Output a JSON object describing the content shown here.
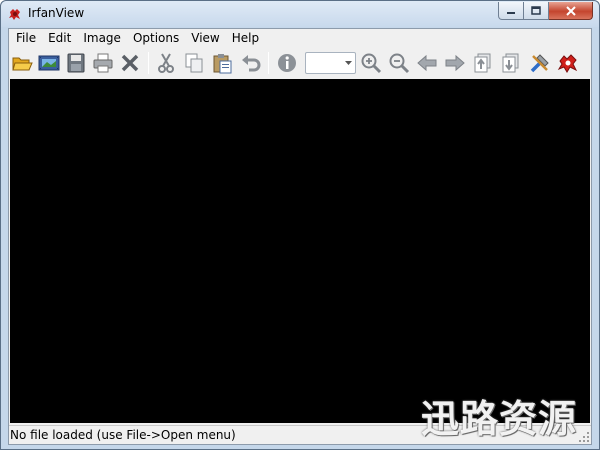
{
  "window": {
    "title": "IrfanView"
  },
  "menu": [
    "File",
    "Edit",
    "Image",
    "Options",
    "View",
    "Help"
  ],
  "toolbar": {
    "icons": [
      "open-folder-icon",
      "slideshow-icon",
      "save-icon",
      "print-icon",
      "delete-icon",
      "cut-icon",
      "copy-icon",
      "paste-icon",
      "undo-icon",
      "info-icon",
      "zoom-in-icon",
      "zoom-out-icon",
      "previous-icon",
      "next-icon",
      "first-page-icon",
      "last-page-icon",
      "settings-icon",
      "irfanview-icon"
    ],
    "zoom_value": ""
  },
  "status": {
    "text": "No file loaded (use File->Open menu)"
  },
  "watermark": "迅路资源",
  "colors": {
    "viewer_bg": "#000000",
    "chrome": "#f0f0f0",
    "title_bar": "#c5d7ea"
  }
}
